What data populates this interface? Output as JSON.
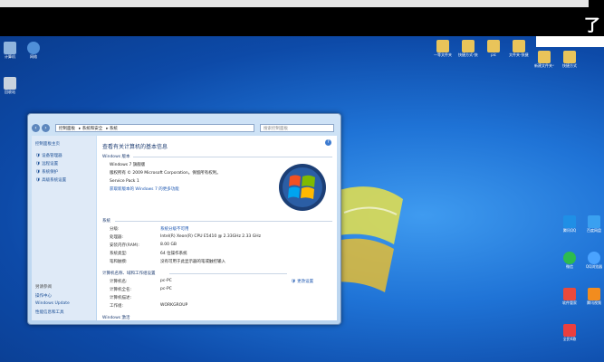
{
  "top_glyph": "了",
  "desktop_icons_left": [
    {
      "label": "计算机"
    },
    {
      "label": "网络"
    },
    {
      "label": "回收站"
    }
  ],
  "desktop_icons_top": [
    {
      "label": "一等文件夹"
    },
    {
      "label": "快捷方式-快捷方式"
    },
    {
      "label": "pic"
    },
    {
      "label": "文件夹-快捷方式"
    },
    {
      "label": "新建文件夹-快捷方式"
    },
    {
      "label": "快捷方式"
    }
  ],
  "desktop_icons_right": [
    {
      "label": "腾讯QQ",
      "color": "#1f8fe6"
    },
    {
      "label": "百度网盘",
      "color": "#3aa0f0"
    },
    {
      "label": "微信",
      "color": "#2dbb4e"
    },
    {
      "label": "QQ浏览器",
      "color": "#4aa3ff"
    },
    {
      "label": "软件管家",
      "color": "#e94a3c"
    },
    {
      "label": "腾讯视频",
      "color": "#f28c1e"
    },
    {
      "label": "全民K歌",
      "color": "#ea3f3f"
    }
  ],
  "window": {
    "breadcrumb": [
      "控制面板",
      "系统和安全",
      "系统"
    ],
    "search_placeholder": "搜索控制面板",
    "sidebar": {
      "home": "控制面板主页",
      "items": [
        "设备管理器",
        "远程设置",
        "系统保护",
        "高级系统设置"
      ],
      "see_also": "另请参阅",
      "bottom": [
        "操作中心",
        "Windows Update",
        "性能信息和工具"
      ]
    },
    "content": {
      "title": "查看有关计算机的基本信息",
      "edition_header": "Windows 版本",
      "edition": "Windows 7 旗舰版",
      "copyright": "版权所有 © 2009 Microsoft Corporation。保留所有权利。",
      "service_pack": "Service Pack 1",
      "more_features": "获取新版本的 Windows 7 的更多功能",
      "system_header": "系统",
      "rows": [
        {
          "label": "分级:",
          "value": "系统分级不可用",
          "link": true
        },
        {
          "label": "处理器:",
          "value": "Intel(R) Xeon(R) CPU    E5410  @ 2.33GHz   2.33 GHz",
          "link": false
        },
        {
          "label": "安装内存(RAM):",
          "value": "8.00 GB",
          "link": false
        },
        {
          "label": "系统类型:",
          "value": "64 位操作系统",
          "link": false
        },
        {
          "label": "笔和触摸:",
          "value": "没有可用于此显示器的笔或触控输入",
          "link": false
        }
      ],
      "name_header": "计算机名称、域和工作组设置",
      "change_settings": "更改设置",
      "name_rows": [
        {
          "label": "计算机名:",
          "value": "pc-PC"
        },
        {
          "label": "计算机全名:",
          "value": "pc-PC"
        },
        {
          "label": "计算机描述:",
          "value": ""
        },
        {
          "label": "工作组:",
          "value": "WORKGROUP"
        }
      ],
      "activation_header": "Windows 激活"
    }
  }
}
